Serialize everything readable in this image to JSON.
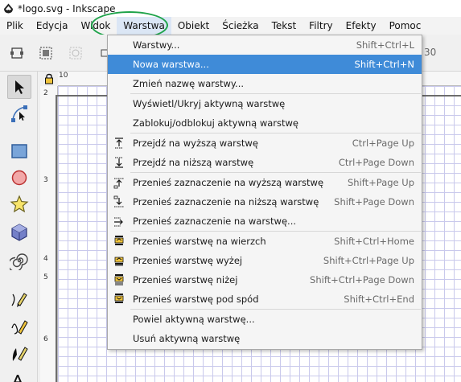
{
  "window": {
    "title": "*logo.svg - Inkscape"
  },
  "menubar": [
    {
      "name": "menu-plik",
      "label": "Plik",
      "active": false
    },
    {
      "name": "menu-edycja",
      "label": "Edycja",
      "active": false
    },
    {
      "name": "menu-widok",
      "label": "Widok",
      "active": false
    },
    {
      "name": "menu-warstwa",
      "label": "Warstwa",
      "active": true
    },
    {
      "name": "menu-obiekt",
      "label": "Obiekt",
      "active": false
    },
    {
      "name": "menu-sciezka",
      "label": "Ścieżka",
      "active": false
    },
    {
      "name": "menu-tekst",
      "label": "Tekst",
      "active": false
    },
    {
      "name": "menu-filtry",
      "label": "Filtry",
      "active": false
    },
    {
      "name": "menu-efekty",
      "label": "Efekty",
      "active": false
    },
    {
      "name": "menu-pomoc",
      "label": "Pomoc",
      "active": false
    }
  ],
  "toolbar": {
    "partial_text": "30"
  },
  "rulers": {
    "top_label": "10",
    "left_labels": [
      "2",
      "3",
      "4",
      "5",
      "6"
    ]
  },
  "dropdown": {
    "groups": [
      [
        {
          "label": "Warstwy...",
          "shortcut": "Shift+Ctrl+L",
          "icon": "",
          "highlight": false
        },
        {
          "label": "Nowa warstwa...",
          "shortcut": "Shift+Ctrl+N",
          "icon": "",
          "highlight": true
        },
        {
          "label": "Zmień nazwę warstwy...",
          "shortcut": "",
          "icon": "",
          "highlight": false
        }
      ],
      [
        {
          "label": "Wyświetl/Ukryj aktywną warstwę",
          "shortcut": "",
          "icon": "",
          "highlight": false
        },
        {
          "label": "Zablokuj/odblokuj aktywną warstwę",
          "shortcut": "",
          "icon": "",
          "highlight": false
        }
      ],
      [
        {
          "label": "Przejdź na wyższą warstwę",
          "shortcut": "Ctrl+Page Up",
          "icon": "layer-up-icon",
          "highlight": false
        },
        {
          "label": "Przejdź na niższą warstwę",
          "shortcut": "Ctrl+Page Down",
          "icon": "layer-down-icon",
          "highlight": false
        }
      ],
      [
        {
          "label": "Przenieś zaznaczenie na wyższą warstwę",
          "shortcut": "Shift+Page Up",
          "icon": "move-selection-up-icon",
          "highlight": false
        },
        {
          "label": "Przenieś zaznaczenie na niższą warstwę",
          "shortcut": "Shift+Page Down",
          "icon": "move-selection-down-icon",
          "highlight": false
        },
        {
          "label": "Przenieś zaznaczenie na warstwę...",
          "shortcut": "",
          "icon": "move-selection-to-layer-icon",
          "highlight": false
        }
      ],
      [
        {
          "label": "Przenieś warstwę na wierzch",
          "shortcut": "Shift+Ctrl+Home",
          "icon": "layer-top-icon",
          "highlight": false
        },
        {
          "label": "Przenieś warstwę wyżej",
          "shortcut": "Shift+Ctrl+Page Up",
          "icon": "layer-raise-icon",
          "highlight": false
        },
        {
          "label": "Przenieś warstwę niżej",
          "shortcut": "Shift+Ctrl+Page Down",
          "icon": "layer-lower-icon",
          "highlight": false
        },
        {
          "label": "Przenieś warstwę pod spód",
          "shortcut": "Shift+Ctrl+End",
          "icon": "layer-bottom-icon",
          "highlight": false
        }
      ],
      [
        {
          "label": "Powiel aktywną warstwę...",
          "shortcut": "",
          "icon": "",
          "highlight": false
        },
        {
          "label": "Usuń aktywną warstwę",
          "shortcut": "",
          "icon": "",
          "highlight": false
        }
      ]
    ]
  },
  "colors": {
    "highlight": "#3f8bd8",
    "annotation": "#1ea34a",
    "grid": "#c9c9ec"
  }
}
